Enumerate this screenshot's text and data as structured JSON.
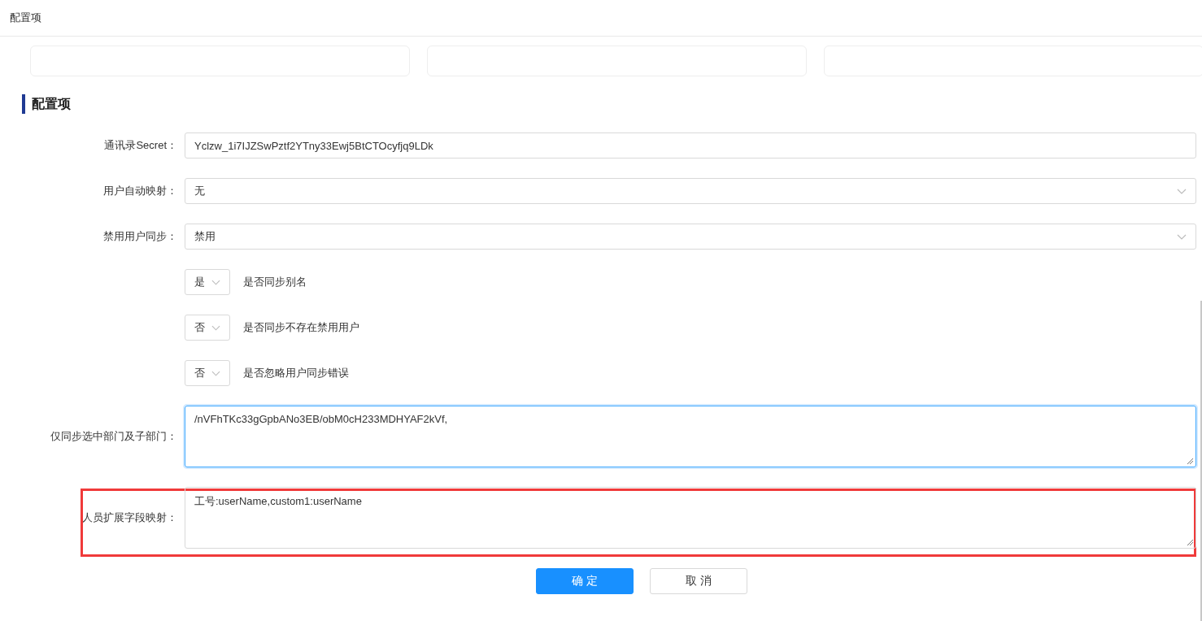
{
  "header": {
    "title": "配置项"
  },
  "section": {
    "title": "配置项"
  },
  "form": {
    "fields": [
      {
        "kind": "input",
        "label": "通讯录Secret：",
        "value": "Yclzw_1i7IJZSwPztf2YTny33Ewj5BtCTOcyfjq9LDk"
      },
      {
        "kind": "select",
        "label": "用户自动映射：",
        "value": "无"
      },
      {
        "kind": "select",
        "label": "禁用用户同步：",
        "value": "禁用"
      },
      {
        "kind": "toggle",
        "value": "是",
        "description": "是否同步别名"
      },
      {
        "kind": "toggle",
        "value": "否",
        "description": "是否同步不存在禁用用户"
      },
      {
        "kind": "toggle",
        "value": "否",
        "description": "是否忽略用户同步错误"
      },
      {
        "kind": "textarea",
        "label": "仅同步选中部门及子部门：",
        "value": "/nVFhTKc33gGpbANo3EB/obM0cH233MDHYAF2kVf,",
        "focused": true,
        "highlighted": false
      },
      {
        "kind": "textarea",
        "label": "人员扩展字段映射：",
        "value": "工号:userName,custom1:userName",
        "focused": false,
        "highlighted": true
      }
    ]
  },
  "buttons": [
    {
      "kind": "primary",
      "label": "确 定"
    },
    {
      "kind": "default",
      "label": "取 消"
    }
  ]
}
